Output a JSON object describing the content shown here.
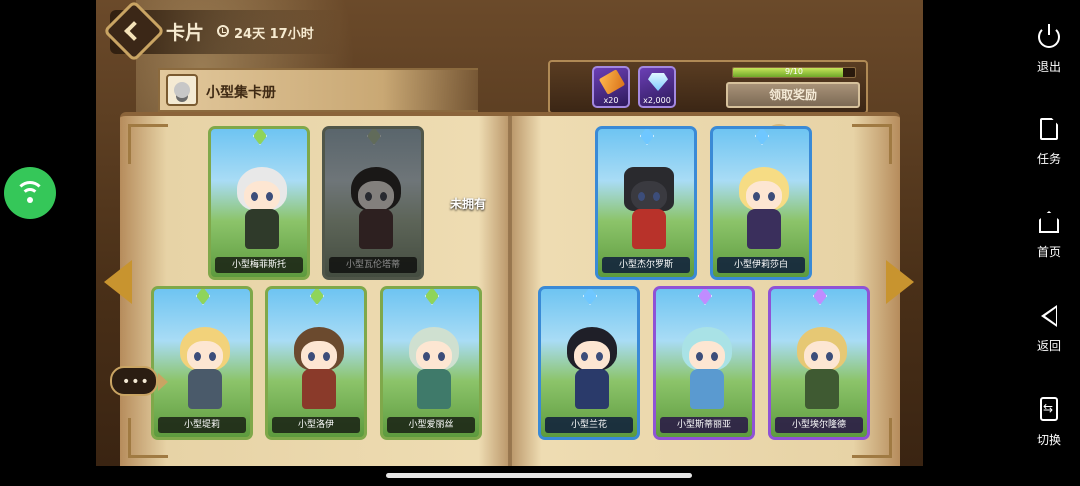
{
  "header": {
    "title": "卡片",
    "timer": "24天 17小时"
  },
  "album": {
    "name": "小型集卡册"
  },
  "rewards": {
    "items": [
      {
        "icon": "ticket-icon",
        "qty": "x20"
      },
      {
        "icon": "gem-icon",
        "qty": "x2,000"
      }
    ],
    "progress_text": "9/10",
    "progress_fraction": 0.9,
    "claim_label": "领取奖励"
  },
  "cards": {
    "left_page": [
      {
        "name": "小型梅菲斯托",
        "owned": true,
        "rarity": "green"
      },
      {
        "name": "小型瓦伦塔蒂",
        "owned": false,
        "rarity": "green"
      },
      {
        "name": "小型堤莉",
        "owned": true,
        "rarity": "green"
      },
      {
        "name": "小型洛伊",
        "owned": true,
        "rarity": "green"
      },
      {
        "name": "小型爱丽丝",
        "owned": true,
        "rarity": "green"
      }
    ],
    "right_page": [
      {
        "name": "小型杰尔罗斯",
        "owned": true,
        "rarity": "blue",
        "badge": "+1"
      },
      {
        "name": "小型伊莉莎白",
        "owned": true,
        "rarity": "blue"
      },
      {
        "name": "小型兰花",
        "owned": true,
        "rarity": "blue"
      },
      {
        "name": "小型斯蒂丽亚",
        "owned": true,
        "rarity": "purple"
      },
      {
        "name": "小型埃尔隆德",
        "owned": true,
        "rarity": "purple"
      }
    ],
    "not_owned_label": "未拥有"
  },
  "system_bar": {
    "items": [
      {
        "icon": "power-icon",
        "label": "退出"
      },
      {
        "icon": "task-icon",
        "label": "任务"
      },
      {
        "icon": "home-icon",
        "label": "首页"
      },
      {
        "icon": "back-icon",
        "label": "返回"
      },
      {
        "icon": "switch-icon",
        "label": "切换"
      }
    ]
  },
  "colors": {
    "green_frame": "#7fa84a",
    "blue_frame": "#3a8ad6",
    "purple_frame": "#8f52d6",
    "wifi_green": "#35c759",
    "gold_accent": "#c8942f"
  }
}
